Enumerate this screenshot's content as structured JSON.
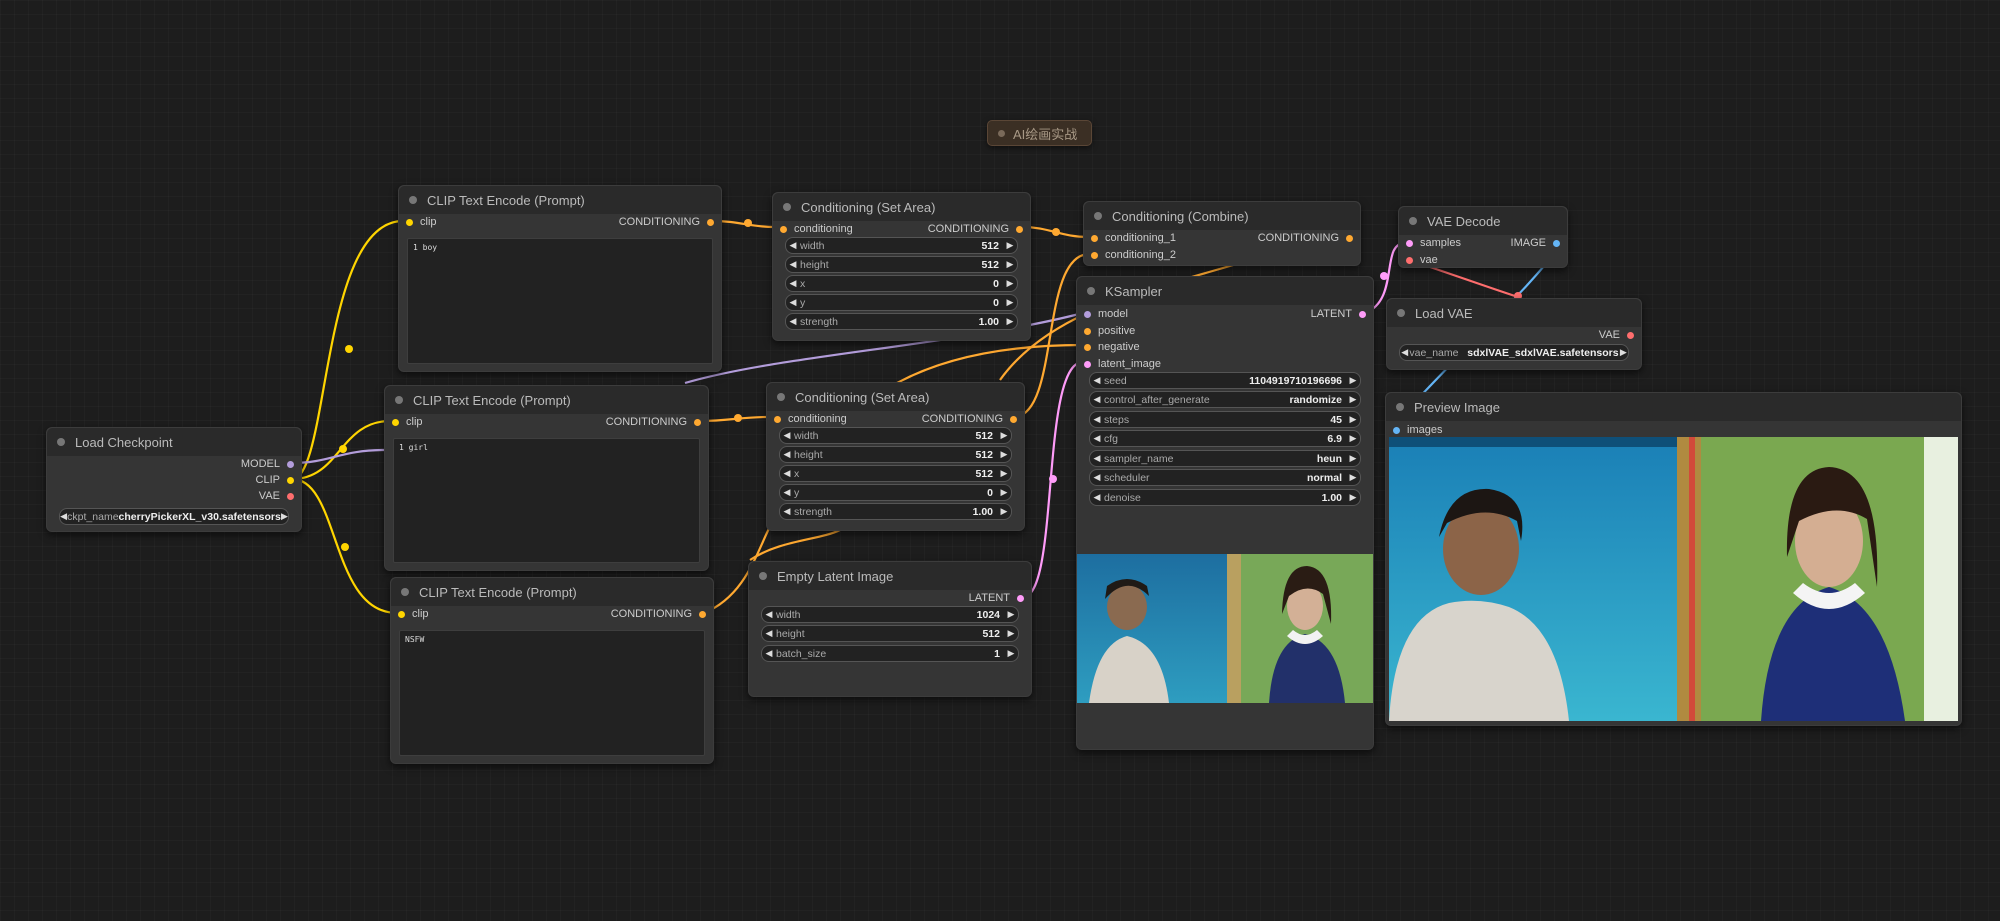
{
  "group": {
    "label": "AI绘画实战"
  },
  "colors": {
    "clip": "#ffd500",
    "conditioning": "#ffa931",
    "model": "#b39ddb",
    "vae": "#ff6e6e",
    "latent": "#ff9cf9",
    "image": "#64b5f6"
  },
  "nodes": {
    "load_checkpoint": {
      "title": "Load Checkpoint",
      "outputs": [
        "MODEL",
        "CLIP",
        "VAE"
      ],
      "ckpt_label": "ckpt_name",
      "ckpt_value": "cherryPickerXL_v30.safetensors"
    },
    "clip1": {
      "title": "CLIP Text Encode (Prompt)",
      "input": "clip",
      "output": "CONDITIONING",
      "text": "1 boy"
    },
    "clip2": {
      "title": "CLIP Text Encode (Prompt)",
      "input": "clip",
      "output": "CONDITIONING",
      "text": "1 girl"
    },
    "clip3": {
      "title": "CLIP Text Encode (Prompt)",
      "input": "clip",
      "output": "CONDITIONING",
      "text": "NSFW"
    },
    "setarea1": {
      "title": "Conditioning (Set Area)",
      "input": "conditioning",
      "output": "CONDITIONING",
      "widgets": [
        {
          "label": "width",
          "value": "512"
        },
        {
          "label": "height",
          "value": "512"
        },
        {
          "label": "x",
          "value": "0"
        },
        {
          "label": "y",
          "value": "0"
        },
        {
          "label": "strength",
          "value": "1.00"
        }
      ]
    },
    "setarea2": {
      "title": "Conditioning (Set Area)",
      "input": "conditioning",
      "output": "CONDITIONING",
      "widgets": [
        {
          "label": "width",
          "value": "512"
        },
        {
          "label": "height",
          "value": "512"
        },
        {
          "label": "x",
          "value": "512"
        },
        {
          "label": "y",
          "value": "0"
        },
        {
          "label": "strength",
          "value": "1.00"
        }
      ]
    },
    "combine": {
      "title": "Conditioning (Combine)",
      "inputs": [
        "conditioning_1",
        "conditioning_2"
      ],
      "output": "CONDITIONING"
    },
    "ksampler": {
      "title": "KSampler",
      "inputs": [
        "model",
        "positive",
        "negative",
        "latent_image"
      ],
      "output": "LATENT",
      "widgets": [
        {
          "label": "seed",
          "value": "1104919710196696"
        },
        {
          "label": "control_after_generate",
          "value": "randomize"
        },
        {
          "label": "steps",
          "value": "45"
        },
        {
          "label": "cfg",
          "value": "6.9"
        },
        {
          "label": "sampler_name",
          "value": "heun"
        },
        {
          "label": "scheduler",
          "value": "normal"
        },
        {
          "label": "denoise",
          "value": "1.00"
        }
      ]
    },
    "empty_latent": {
      "title": "Empty Latent Image",
      "output": "LATENT",
      "widgets": [
        {
          "label": "width",
          "value": "1024"
        },
        {
          "label": "height",
          "value": "512"
        },
        {
          "label": "batch_size",
          "value": "1"
        }
      ]
    },
    "vae_decode": {
      "title": "VAE Decode",
      "inputs": [
        "samples",
        "vae"
      ],
      "output": "IMAGE"
    },
    "load_vae": {
      "title": "Load VAE",
      "output": "VAE",
      "vae_label": "vae_name",
      "vae_value": "sdxlVAE_sdxlVAE.safetensors"
    },
    "preview": {
      "title": "Preview Image",
      "input": "images"
    }
  }
}
